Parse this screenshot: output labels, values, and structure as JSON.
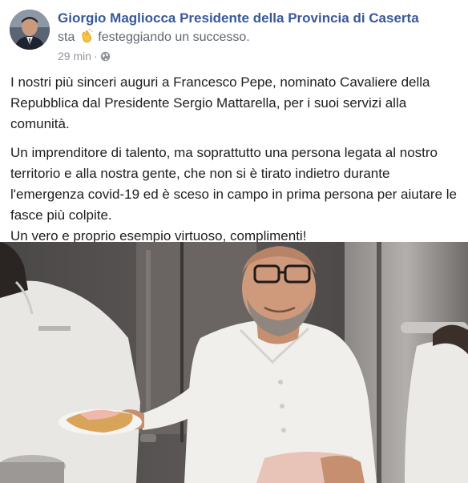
{
  "post": {
    "author": "Giorgio Magliocca Presidente della Provincia di Caserta",
    "activity_prefix": "sta",
    "activity_text": "festeggiando un successo.",
    "activity_emoji": "clapping-hands-icon",
    "timestamp": "29 min",
    "separator": "·",
    "audience_icon": "globe-icon",
    "paragraphs": [
      "I nostri più sinceri auguri a Francesco Pepe, nominato Cavaliere della Repubblica dal Presidente Sergio Mattarella, per i suoi servizi alla comunità.",
      "Un imprenditore di talento, ma soprattutto una persona legata al nostro territorio e alla nostra gente, che non si è tirato indietro durante l'emergenza covid-19 ed è sceso in campo in prima persona per aiutare le fasce più colpite.",
      "Un vero e proprio esempio virtuoso, complimenti!"
    ]
  },
  "colors": {
    "author_link": "#385898",
    "secondary_text": "#606770",
    "meta_text": "#90949c",
    "body_text": "#1c1e21"
  }
}
